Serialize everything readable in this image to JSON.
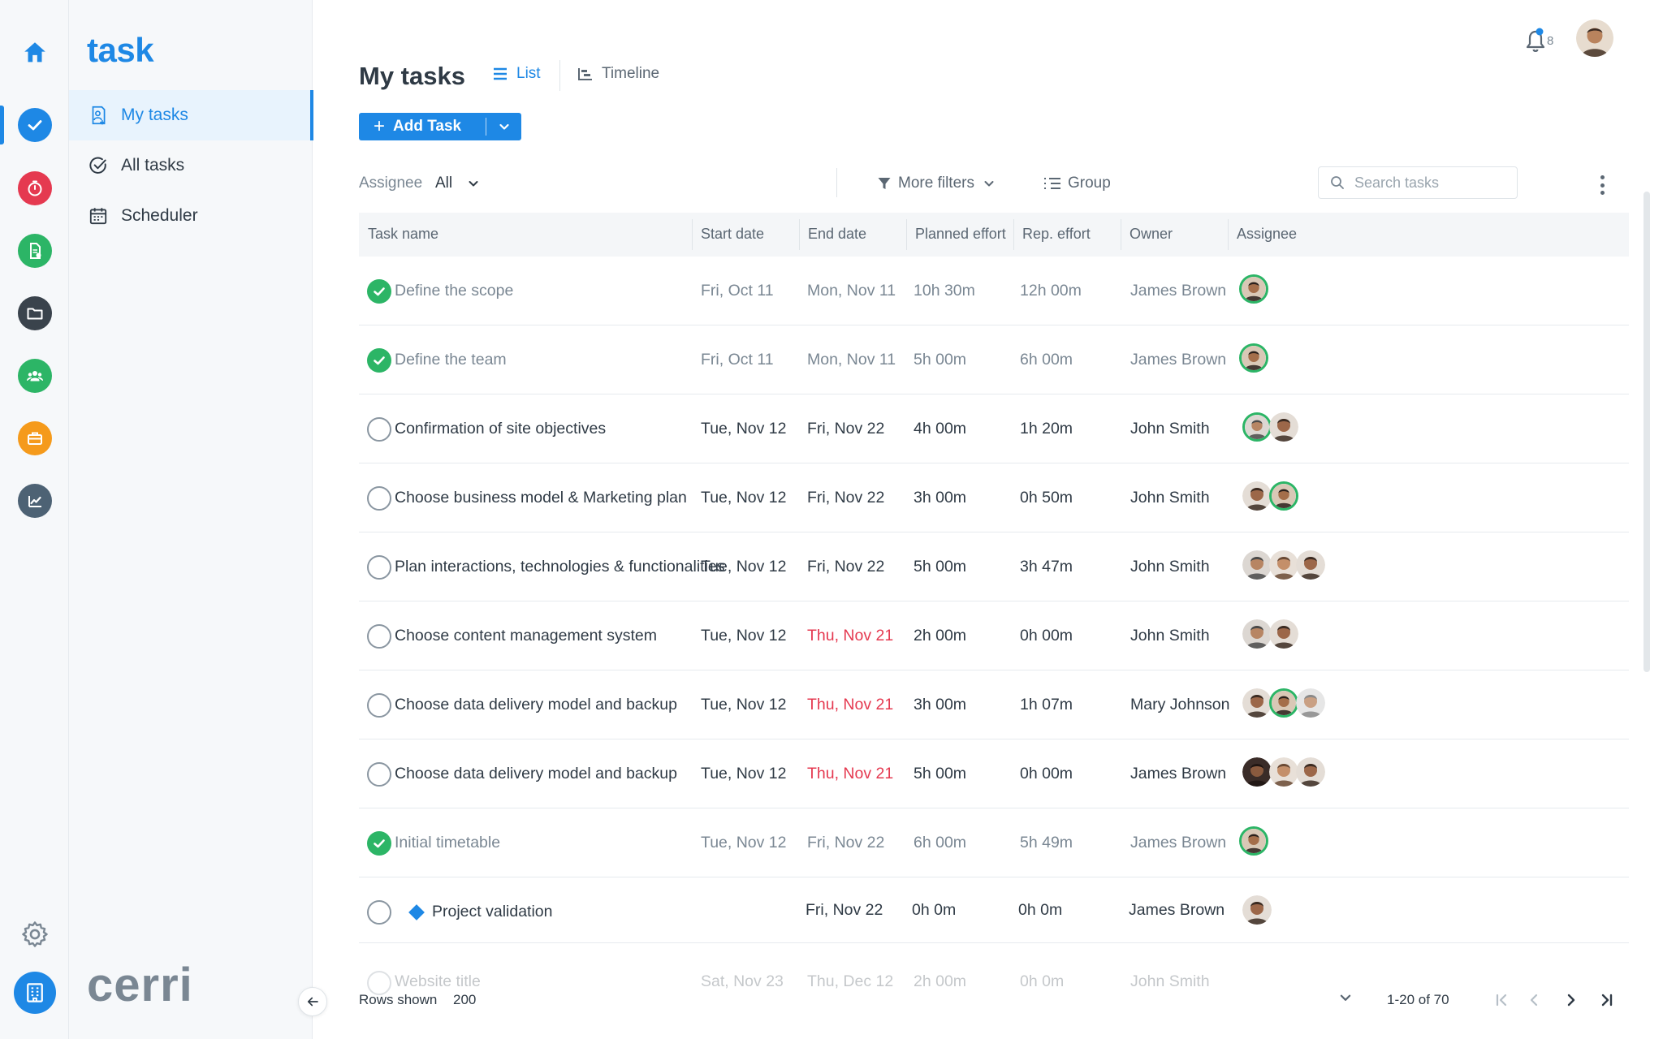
{
  "app": {
    "brand": "task",
    "company_logo": "cerri",
    "colors": {
      "accent": "#1e88e5",
      "success": "#2cb566",
      "danger": "#e53950"
    }
  },
  "rail": {
    "icons": [
      "home-icon",
      "tasks-check-icon",
      "timer-icon",
      "document-icon",
      "folder-icon",
      "team-icon",
      "briefcase-icon",
      "reports-icon",
      "gear-icon",
      "company-icon"
    ]
  },
  "sidebar": {
    "items": [
      {
        "label": "My tasks",
        "icon": "person-tasks-icon",
        "active": true
      },
      {
        "label": "All tasks",
        "icon": "check-circle-icon",
        "active": false
      },
      {
        "label": "Scheduler",
        "icon": "calendar-icon",
        "active": false
      }
    ]
  },
  "header": {
    "notifications_count": "8",
    "title": "My tasks",
    "views": [
      {
        "label": "List",
        "active": true
      },
      {
        "label": "Timeline",
        "active": false
      }
    ],
    "add_task_label": "Add Task"
  },
  "filters": {
    "assignee_label": "Assignee",
    "assignee_value": "All",
    "more_filters": "More filters",
    "group": "Group",
    "search_placeholder": "Search tasks"
  },
  "table": {
    "columns": [
      "Task name",
      "Start date",
      "End date",
      "Planned effort",
      "Rep. effort",
      "Owner",
      "Assignee"
    ],
    "rows": [
      {
        "name": "Define the scope",
        "start": "Fri, Oct 11",
        "end": "Mon, Nov 11",
        "planned": "10h 30m",
        "reported": "12h 00m",
        "owner": "James Brown",
        "done": true,
        "overdue": false
      },
      {
        "name": "Define the team",
        "start": "Fri, Oct 11",
        "end": "Mon, Nov 11",
        "planned": "5h 00m",
        "reported": "6h 00m",
        "owner": "James Brown",
        "done": true,
        "overdue": false
      },
      {
        "name": "Confirmation of site objectives",
        "start": "Tue, Nov 12",
        "end": "Fri, Nov 22",
        "planned": "4h 00m",
        "reported": "1h 20m",
        "owner": "John Smith",
        "done": false,
        "overdue": false
      },
      {
        "name": "Choose business model & Marketing plan",
        "start": "Tue, Nov 12",
        "end": "Fri, Nov 22",
        "planned": "3h 00m",
        "reported": "0h 50m",
        "owner": "John Smith",
        "done": false,
        "overdue": false
      },
      {
        "name": "Plan interactions, technologies & functionalities",
        "start": "Tue, Nov 12",
        "end": "Fri, Nov 22",
        "planned": "5h 00m",
        "reported": "3h 47m",
        "owner": "John Smith",
        "done": false,
        "overdue": false
      },
      {
        "name": "Choose content management system",
        "start": "Tue, Nov 12",
        "end": "Thu, Nov 21",
        "planned": "2h 00m",
        "reported": "0h 00m",
        "owner": "John Smith",
        "done": false,
        "overdue": true
      },
      {
        "name": "Choose data delivery model and backup",
        "start": "Tue, Nov 12",
        "end": "Thu, Nov 21",
        "planned": "3h 00m",
        "reported": "1h 07m",
        "owner": "Mary Johnson",
        "done": false,
        "overdue": true
      },
      {
        "name": "Choose data delivery model and backup",
        "start": "Tue, Nov 12",
        "end": "Thu, Nov 21",
        "planned": "5h 00m",
        "reported": "0h 00m",
        "owner": "James Brown",
        "done": false,
        "overdue": true
      },
      {
        "name": "Initial timetable",
        "start": "Tue, Nov 12",
        "end": "Fri, Nov 22",
        "planned": "6h 00m",
        "reported": "5h 49m",
        "owner": "James Brown",
        "done": true,
        "overdue": false
      },
      {
        "name": "Project validation",
        "start": "",
        "end": "Fri, Nov 22",
        "planned": "0h 0m",
        "reported": "0h 0m",
        "owner": "James Brown",
        "done": false,
        "overdue": false,
        "milestone": true
      }
    ],
    "faded_row": {
      "name": "Website title",
      "start": "Sat, Nov 23",
      "end": "Thu, Dec 12",
      "planned": "2h 00m",
      "reported": "0h 0m",
      "owner": "John Smith"
    }
  },
  "footer": {
    "rows_shown_label": "Rows shown",
    "rows_shown_value": "200",
    "page_range": "1-20 of 70"
  }
}
